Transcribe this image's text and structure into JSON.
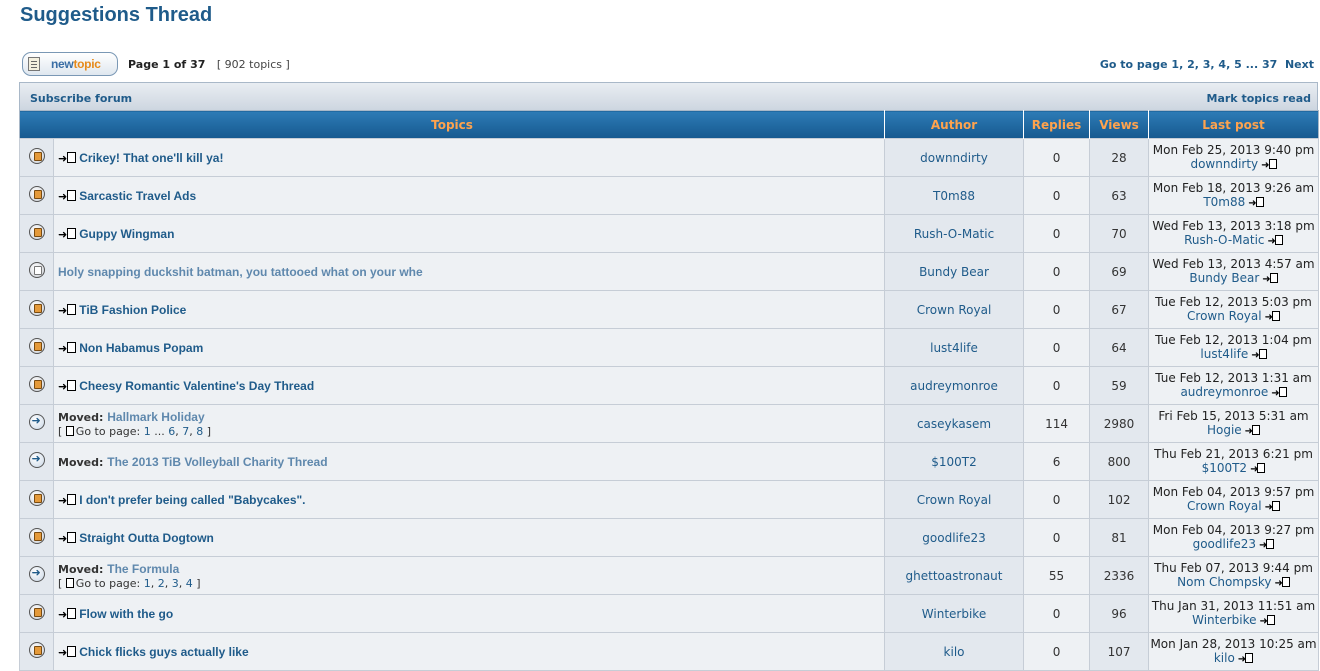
{
  "page_title": "Suggestions Thread",
  "new_topic": {
    "label_part1": "new",
    "label_part2": "topic"
  },
  "page_info": {
    "page_label": "Page",
    "current": "1",
    "of_label": "of",
    "total": "37",
    "topics_count": "[ 902 topics ]"
  },
  "pagination": {
    "label": "Go to page",
    "pages": [
      "1",
      "2",
      "3",
      "4",
      "5"
    ],
    "ellipsis": "...",
    "last": "37",
    "next": "Next"
  },
  "subscribe_label": "Subscribe forum",
  "mark_read_label": "Mark topics read",
  "columns": {
    "topics": "Topics",
    "author": "Author",
    "replies": "Replies",
    "views": "Views",
    "last_post": "Last post"
  },
  "moved_prefix": "Moved:",
  "goto_label": "Go to page:",
  "topics": [
    {
      "icon": "new",
      "title": "Crikey! That one'll kill ya!",
      "author": "downndirty",
      "replies": "0",
      "views": "28",
      "last_date": "Mon Feb 25, 2013 9:40 pm",
      "last_user": "downndirty"
    },
    {
      "icon": "new",
      "title": "Sarcastic Travel Ads",
      "author": "T0m88",
      "replies": "0",
      "views": "63",
      "last_date": "Mon Feb 18, 2013 9:26 am",
      "last_user": "T0m88"
    },
    {
      "icon": "new",
      "title": "Guppy Wingman",
      "author": "Rush-O-Matic",
      "replies": "0",
      "views": "70",
      "last_date": "Wed Feb 13, 2013 3:18 pm",
      "last_user": "Rush-O-Matic"
    },
    {
      "icon": "old",
      "title": "Holy snapping duckshit batman, you tattooed what on your whe",
      "author": "Bundy Bear",
      "replies": "0",
      "views": "69",
      "last_date": "Wed Feb 13, 2013 4:57 am",
      "last_user": "Bundy Bear"
    },
    {
      "icon": "new",
      "title": "TiB Fashion Police",
      "author": "Crown Royal",
      "replies": "0",
      "views": "67",
      "last_date": "Tue Feb 12, 2013 5:03 pm",
      "last_user": "Crown Royal"
    },
    {
      "icon": "new",
      "title": "Non Habamus Popam",
      "author": "lust4life",
      "replies": "0",
      "views": "64",
      "last_date": "Tue Feb 12, 2013 1:04 pm",
      "last_user": "lust4life"
    },
    {
      "icon": "new",
      "title": "Cheesy Romantic Valentine's Day Thread",
      "author": "audreymonroe",
      "replies": "0",
      "views": "59",
      "last_date": "Tue Feb 12, 2013 1:31 am",
      "last_user": "audreymonroe"
    },
    {
      "icon": "moved",
      "title": "Hallmark Holiday",
      "goto_pages": [
        "1",
        "...",
        "6",
        "7",
        "8"
      ],
      "author": "caseykasem",
      "replies": "114",
      "views": "2980",
      "last_date": "Fri Feb 15, 2013 5:31 am",
      "last_user": "Hogie"
    },
    {
      "icon": "moved",
      "title": "The 2013 TiB Volleyball Charity Thread",
      "author": "$100T2",
      "replies": "6",
      "views": "800",
      "last_date": "Thu Feb 21, 2013 6:21 pm",
      "last_user": "$100T2"
    },
    {
      "icon": "new",
      "title": "I don't prefer being called \"Babycakes\".",
      "author": "Crown Royal",
      "replies": "0",
      "views": "102",
      "last_date": "Mon Feb 04, 2013 9:57 pm",
      "last_user": "Crown Royal"
    },
    {
      "icon": "new",
      "title": "Straight Outta Dogtown",
      "author": "goodlife23",
      "replies": "0",
      "views": "81",
      "last_date": "Mon Feb 04, 2013 9:27 pm",
      "last_user": "goodlife23"
    },
    {
      "icon": "moved",
      "title": "The Formula",
      "goto_pages": [
        "1",
        "2",
        "3",
        "4"
      ],
      "author": "ghettoastronaut",
      "replies": "55",
      "views": "2336",
      "last_date": "Thu Feb 07, 2013 9:44 pm",
      "last_user": "Nom Chompsky"
    },
    {
      "icon": "new",
      "title": "Flow with the go",
      "author": "Winterbike",
      "replies": "0",
      "views": "96",
      "last_date": "Thu Jan 31, 2013 11:51 am",
      "last_user": "Winterbike"
    },
    {
      "icon": "new",
      "title": "Chick flicks guys actually like",
      "author": "kilo",
      "replies": "0",
      "views": "107",
      "last_date": "Mon Jan 28, 2013 10:25 am",
      "last_user": "kilo"
    }
  ]
}
